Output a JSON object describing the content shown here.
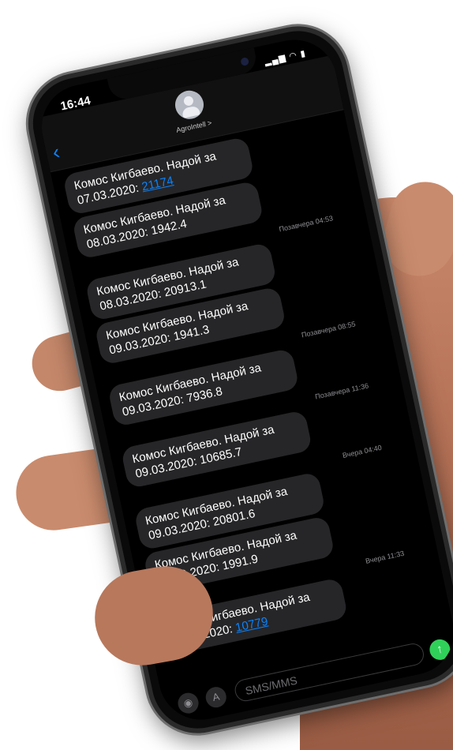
{
  "status_bar": {
    "time": "16:44",
    "icons": "▂▄▆ ◠ ▮"
  },
  "header": {
    "back_glyph": "‹",
    "contact_name": "AgroIntell >"
  },
  "thread": [
    {
      "kind": "message",
      "prefix": "Комос Кигбаево. Надой за 07.03.2020: ",
      "value": "21174",
      "value_is_link": true
    },
    {
      "kind": "message",
      "prefix": "Комос Кигбаево. Надой за 08.03.2020: ",
      "value": "1942.4",
      "value_is_link": false
    },
    {
      "kind": "timestamp",
      "text": "Позавчера 04:53"
    },
    {
      "kind": "message",
      "prefix": "Комос Кигбаево. Надой за 08.03.2020: ",
      "value": "20913.1",
      "value_is_link": false
    },
    {
      "kind": "message",
      "prefix": "Комос Кигбаево. Надой за 09.03.2020: ",
      "value": "1941.3",
      "value_is_link": false
    },
    {
      "kind": "timestamp",
      "text": "Позавчера 08:55"
    },
    {
      "kind": "message",
      "prefix": "Комос Кигбаево. Надой за 09.03.2020: ",
      "value": "7936.8",
      "value_is_link": false
    },
    {
      "kind": "timestamp",
      "text": "Позавчера 11:36"
    },
    {
      "kind": "message",
      "prefix": "Комос Кигбаево. Надой за 09.03.2020: ",
      "value": "10685.7",
      "value_is_link": false
    },
    {
      "kind": "timestamp",
      "text": "Вчера 04:40"
    },
    {
      "kind": "message",
      "prefix": "Комос Кигбаево. Надой за 09.03.2020: ",
      "value": "20801.6",
      "value_is_link": false
    },
    {
      "kind": "message",
      "prefix": "Комос Кигбаево. Надой за 10.03.2020: ",
      "value": "1991.9",
      "value_is_link": false
    },
    {
      "kind": "timestamp",
      "text": "Вчера 11:33"
    },
    {
      "kind": "message",
      "prefix": "Комос Кигбаево. Надой за 10.03.2020: ",
      "value": "10779",
      "value_is_link": true
    }
  ],
  "input_bar": {
    "placeholder": "SMS/MMS",
    "camera_icon": "camera-icon",
    "apps_icon": "app-store-icon",
    "send_icon": "send-arrow-icon"
  },
  "colors": {
    "link": "#0a84ff",
    "bubble": "#262628",
    "send": "#30d158"
  }
}
